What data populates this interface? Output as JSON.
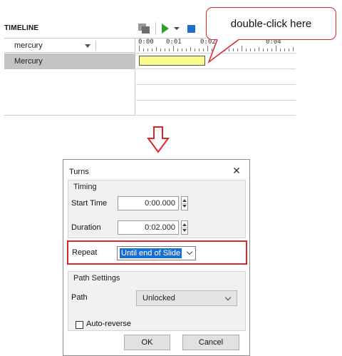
{
  "timeline": {
    "title": "TIMELINE",
    "object_selector_value": "mercury",
    "object_row_label": "Mercury",
    "ruler_labels": [
      "0:00",
      "0:01",
      "0:02",
      "0:04"
    ]
  },
  "callout": {
    "text": "double-click here"
  },
  "dialog": {
    "title": "Turns",
    "close_glyph": "✕",
    "timing": {
      "group_label": "Timing",
      "start_time_label": "Start Time",
      "start_time_value": "0:00.000",
      "duration_label": "Duration",
      "duration_value": "0:02.000"
    },
    "repeat": {
      "label": "Repeat",
      "value": "Until end of Slide"
    },
    "path_settings": {
      "group_label": "Path Settings",
      "path_label": "Path",
      "path_value": "Unlocked",
      "auto_reverse_label": "Auto-reverse",
      "auto_reverse_checked": false
    },
    "buttons": {
      "ok": "OK",
      "cancel": "Cancel"
    }
  },
  "colors": {
    "highlight_red": "#d9262a",
    "play_green": "#2f9d2f",
    "stop_blue": "#1f6fc9",
    "selection_blue": "#1b6fd1",
    "animation_bar": "#fbfb8e"
  },
  "icons": {
    "layers": "layers-icon",
    "play": "play-icon",
    "dropdown": "play-options-icon",
    "stop": "stop-icon",
    "down_arrow": "down-arrow-icon"
  }
}
